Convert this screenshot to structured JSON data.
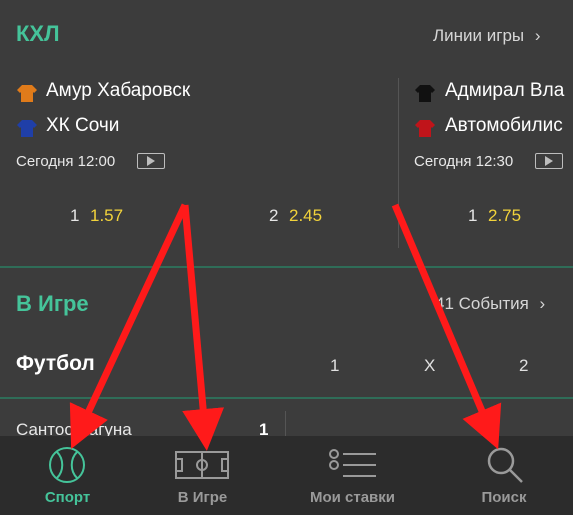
{
  "khl": {
    "title": "КХЛ",
    "lines_link": "Линии игры",
    "matches": [
      {
        "team1": "Амур Хабаровск",
        "team1_color": "#e07b1a",
        "team2": "ХК Сочи",
        "team2_color": "#1f3fa8",
        "time": "Сегодня 12:00",
        "odds": [
          {
            "label": "1",
            "value": "1.57"
          },
          {
            "label": "2",
            "value": "2.45"
          }
        ]
      },
      {
        "team1": "Адмирал Вла",
        "team1_color": "#111111",
        "team2": "Автомобилис",
        "team2_color": "#c0141a",
        "time": "Сегодня 12:30",
        "odds": [
          {
            "label": "1",
            "value": "2.75"
          }
        ]
      }
    ]
  },
  "live": {
    "title": "В Игре",
    "events_link": "41 События",
    "sport": "Футбол",
    "columns": [
      "1",
      "X",
      "2"
    ],
    "partial_row": {
      "team": "Сантос Лагуна",
      "score": "1"
    }
  },
  "bottom_nav": {
    "items": [
      {
        "label": "Спорт",
        "icon": "tennis-ball-icon",
        "active": true
      },
      {
        "label": "В Игре",
        "icon": "field-icon",
        "active": false
      },
      {
        "label": "Мои ставки",
        "icon": "bets-list-icon",
        "active": false
      },
      {
        "label": "Поиск",
        "icon": "search-icon",
        "active": false
      }
    ]
  },
  "colors": {
    "accent": "#45c49a",
    "odds": "#f2d33b",
    "arrow": "#ff1a1a",
    "background": "#3c3c3c",
    "nav_background": "#2c2c2c"
  }
}
